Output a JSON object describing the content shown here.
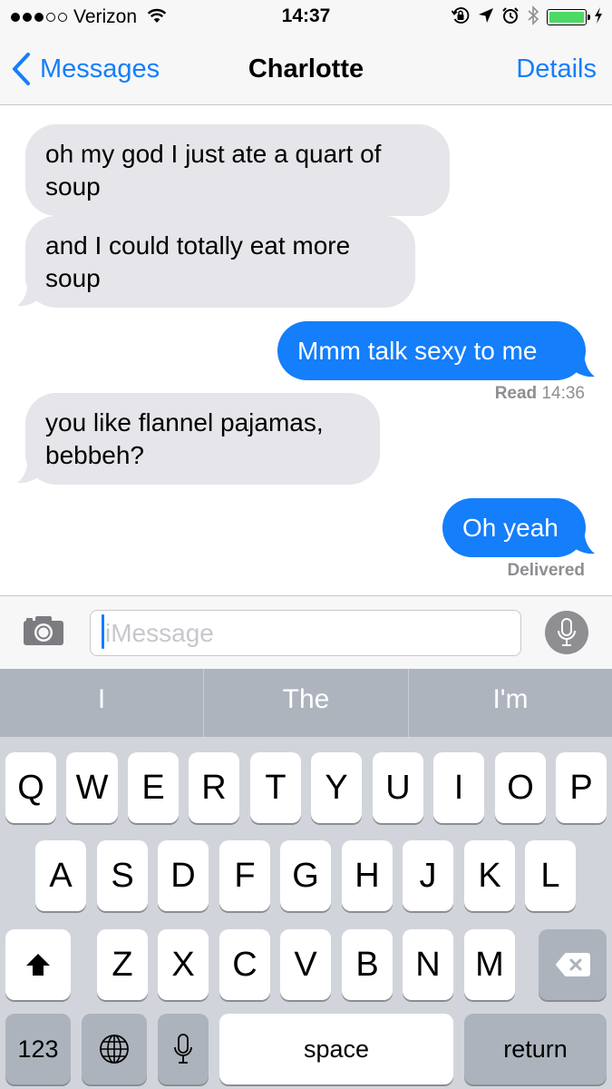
{
  "status_bar": {
    "carrier": "Verizon",
    "time": "14:37",
    "signal_bars_filled": 3,
    "signal_bars_total": 5,
    "battery_level": 1.0,
    "icons": [
      "wifi-icon",
      "rotation-lock-icon",
      "location-icon",
      "alarm-icon",
      "bluetooth-icon",
      "battery-icon",
      "charging-icon"
    ]
  },
  "nav": {
    "back_label": "Messages",
    "title": "Charlotte",
    "details_label": "Details"
  },
  "messages": [
    {
      "direction": "incoming",
      "text": "oh my god I just ate a quart of soup"
    },
    {
      "direction": "incoming",
      "text": "and I could totally eat more soup"
    },
    {
      "direction": "outgoing",
      "text": "Mmm talk sexy to me"
    },
    {
      "direction": "incoming",
      "text": "you like flannel pajamas, bebbeh?"
    },
    {
      "direction": "outgoing",
      "text": "Oh yeah"
    }
  ],
  "receipts": {
    "read_label": "Read",
    "read_time": "14:36",
    "delivered_label": "Delivered"
  },
  "input": {
    "placeholder": "iMessage",
    "value": ""
  },
  "keyboard": {
    "predictions": [
      "I",
      "The",
      "I'm"
    ],
    "row1": [
      "Q",
      "W",
      "E",
      "R",
      "T",
      "Y",
      "U",
      "I",
      "O",
      "P"
    ],
    "row2": [
      "A",
      "S",
      "D",
      "F",
      "G",
      "H",
      "J",
      "K",
      "L"
    ],
    "row3": [
      "Z",
      "X",
      "C",
      "V",
      "B",
      "N",
      "M"
    ],
    "numbers_label": "123",
    "space_label": "space",
    "return_label": "return"
  },
  "colors": {
    "accent_blue": "#147efb",
    "incoming_bubble": "#e5e5ea",
    "receipt_gray": "#8e8e93",
    "keyboard_bg": "#d1d5db",
    "predictive_bg": "#aeb4bd",
    "battery_green": "#4cd964"
  }
}
